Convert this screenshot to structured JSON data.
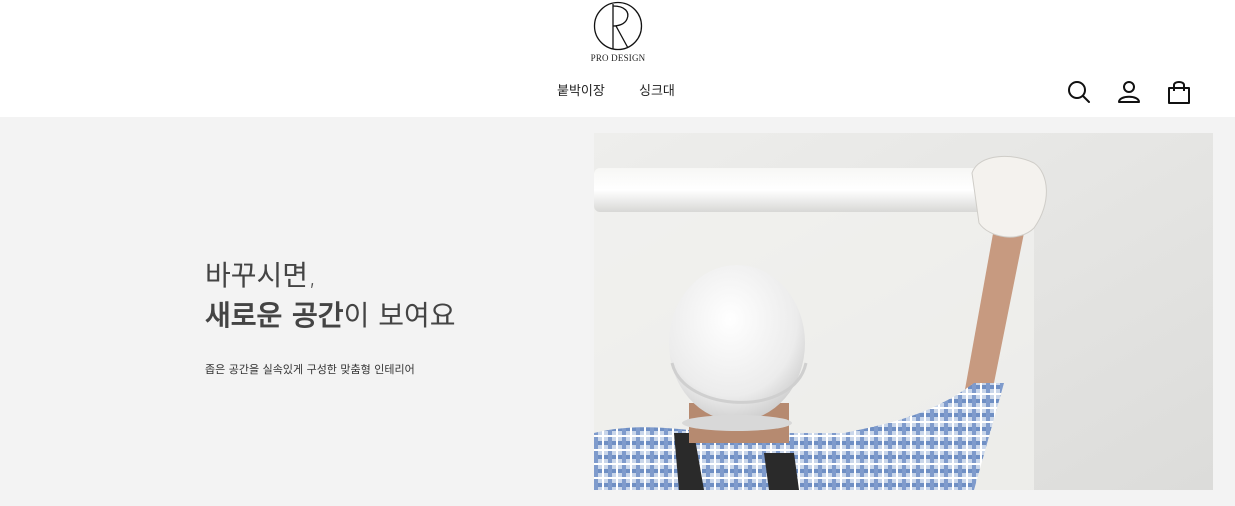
{
  "brand": {
    "logo_letter": "R",
    "name": "PRO DESIGN"
  },
  "nav": {
    "items": [
      {
        "label": "붙박이장"
      },
      {
        "label": "싱크대"
      }
    ]
  },
  "header_icons": [
    "search-icon",
    "user-icon",
    "shopping-bag-icon"
  ],
  "hero": {
    "line1": "바꾸시면,",
    "line2_bold": "새로운 공간",
    "line2_rest": "이 보여요",
    "subtitle": "좁은 공간을 실속있게 구성한 맞춤형 인테리어",
    "image": "worker-hanging-wallpaper-photo"
  },
  "colors": {
    "hero_bg": "#f3f3f3",
    "text": "#444444",
    "header_bg": "#ffffff"
  }
}
